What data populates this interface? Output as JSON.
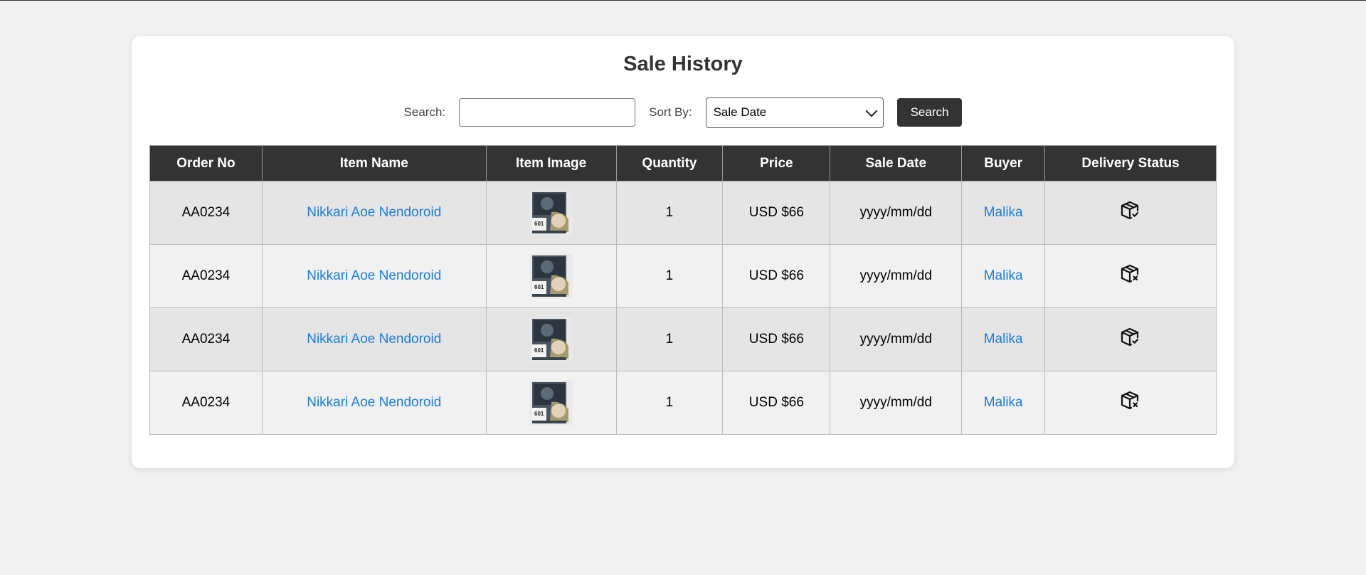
{
  "page": {
    "title": "Sale History"
  },
  "toolbar": {
    "search_label": "Search:",
    "search_value": "",
    "search_placeholder": "",
    "sort_label": "Sort By:",
    "sort_selected": "Sale Date",
    "search_button": "Search"
  },
  "table": {
    "headers": [
      "Order No",
      "Item Name",
      "Item Image",
      "Quantity",
      "Price",
      "Sale Date",
      "Buyer",
      "Delivery Status"
    ],
    "rows": [
      {
        "order_no": "AA0234",
        "item_name": "Nikkari Aoe Nendoroid",
        "item_image": "nendoroid-figure-box",
        "quantity": "1",
        "price": "USD $66",
        "sale_date": "yyyy/mm/dd",
        "buyer": "Malika",
        "delivery_status": "package-check-icon"
      },
      {
        "order_no": "AA0234",
        "item_name": "Nikkari Aoe Nendoroid",
        "item_image": "nendoroid-figure-box",
        "quantity": "1",
        "price": "USD $66",
        "sale_date": "yyyy/mm/dd",
        "buyer": "Malika",
        "delivery_status": "package-x-icon"
      },
      {
        "order_no": "AA0234",
        "item_name": "Nikkari Aoe Nendoroid",
        "item_image": "nendoroid-figure-box",
        "quantity": "1",
        "price": "USD $66",
        "sale_date": "yyyy/mm/dd",
        "buyer": "Malika",
        "delivery_status": "package-check-icon"
      },
      {
        "order_no": "AA0234",
        "item_name": "Nikkari Aoe Nendoroid",
        "item_image": "nendoroid-figure-box",
        "quantity": "1",
        "price": "USD $66",
        "sale_date": "yyyy/mm/dd",
        "buyer": "Malika",
        "delivery_status": "package-x-icon"
      }
    ]
  },
  "colors": {
    "header_bg": "#333333",
    "link": "#1a7de0",
    "row_odd": "#e5e5e5",
    "row_even": "#f1f1f1"
  }
}
